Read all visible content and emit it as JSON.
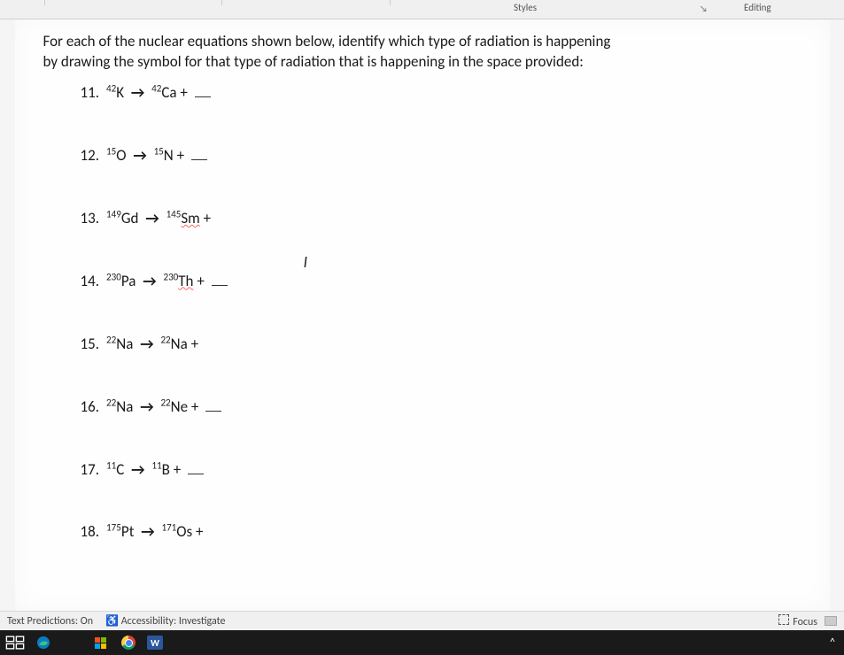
{
  "ribbon": {
    "styles_label": "Styles",
    "editing_label": "Editing"
  },
  "document": {
    "intro_line1": "For each of the nuclear equations shown below, identify which type of radiation is happening",
    "intro_line2": "by drawing the symbol for that type of radiation that is happening in the space provided:",
    "problems": {
      "p11": {
        "n": "11.",
        "lhs_mass": "42",
        "lhs_el": "K",
        "rhs_mass": "42",
        "rhs_el": "Ca",
        "plus": "+"
      },
      "p12": {
        "n": "12.",
        "lhs_mass": "15",
        "lhs_el": "O",
        "rhs_mass": "15",
        "rhs_el": "N",
        "plus": "+"
      },
      "p13": {
        "n": "13.",
        "lhs_mass": "149",
        "lhs_el": "Gd",
        "rhs_mass": "145",
        "rhs_el": "Sm",
        "plus": "+"
      },
      "p14": {
        "n": "14.",
        "lhs_mass": "230",
        "lhs_el": "Pa",
        "rhs_mass": "230",
        "rhs_el": "Th",
        "plus": "+"
      },
      "p15": {
        "n": "15.",
        "lhs_mass": "22",
        "lhs_el": "Na",
        "rhs_mass": "22",
        "rhs_el": "Na",
        "plus": "+"
      },
      "p16": {
        "n": "16.",
        "lhs_mass": "22",
        "lhs_el": "Na",
        "rhs_mass": "22",
        "rhs_el": "Ne",
        "plus": "+"
      },
      "p17": {
        "n": "17.",
        "lhs_mass": "11",
        "lhs_el": "C",
        "rhs_mass": "11",
        "rhs_el": "B",
        "plus": "+"
      },
      "p18": {
        "n": "18.",
        "lhs_mass": "175",
        "lhs_el": "Pt",
        "rhs_mass": "171",
        "rhs_el": "Os",
        "plus": "+"
      }
    },
    "arrow": "→",
    "cursor_glyph": "I"
  },
  "statusbar": {
    "text_predictions": "Text Predictions: On",
    "accessibility": "Accessibility: Investigate",
    "focus": "Focus"
  },
  "taskbar": {
    "word_letter": "W",
    "caret": "^"
  }
}
